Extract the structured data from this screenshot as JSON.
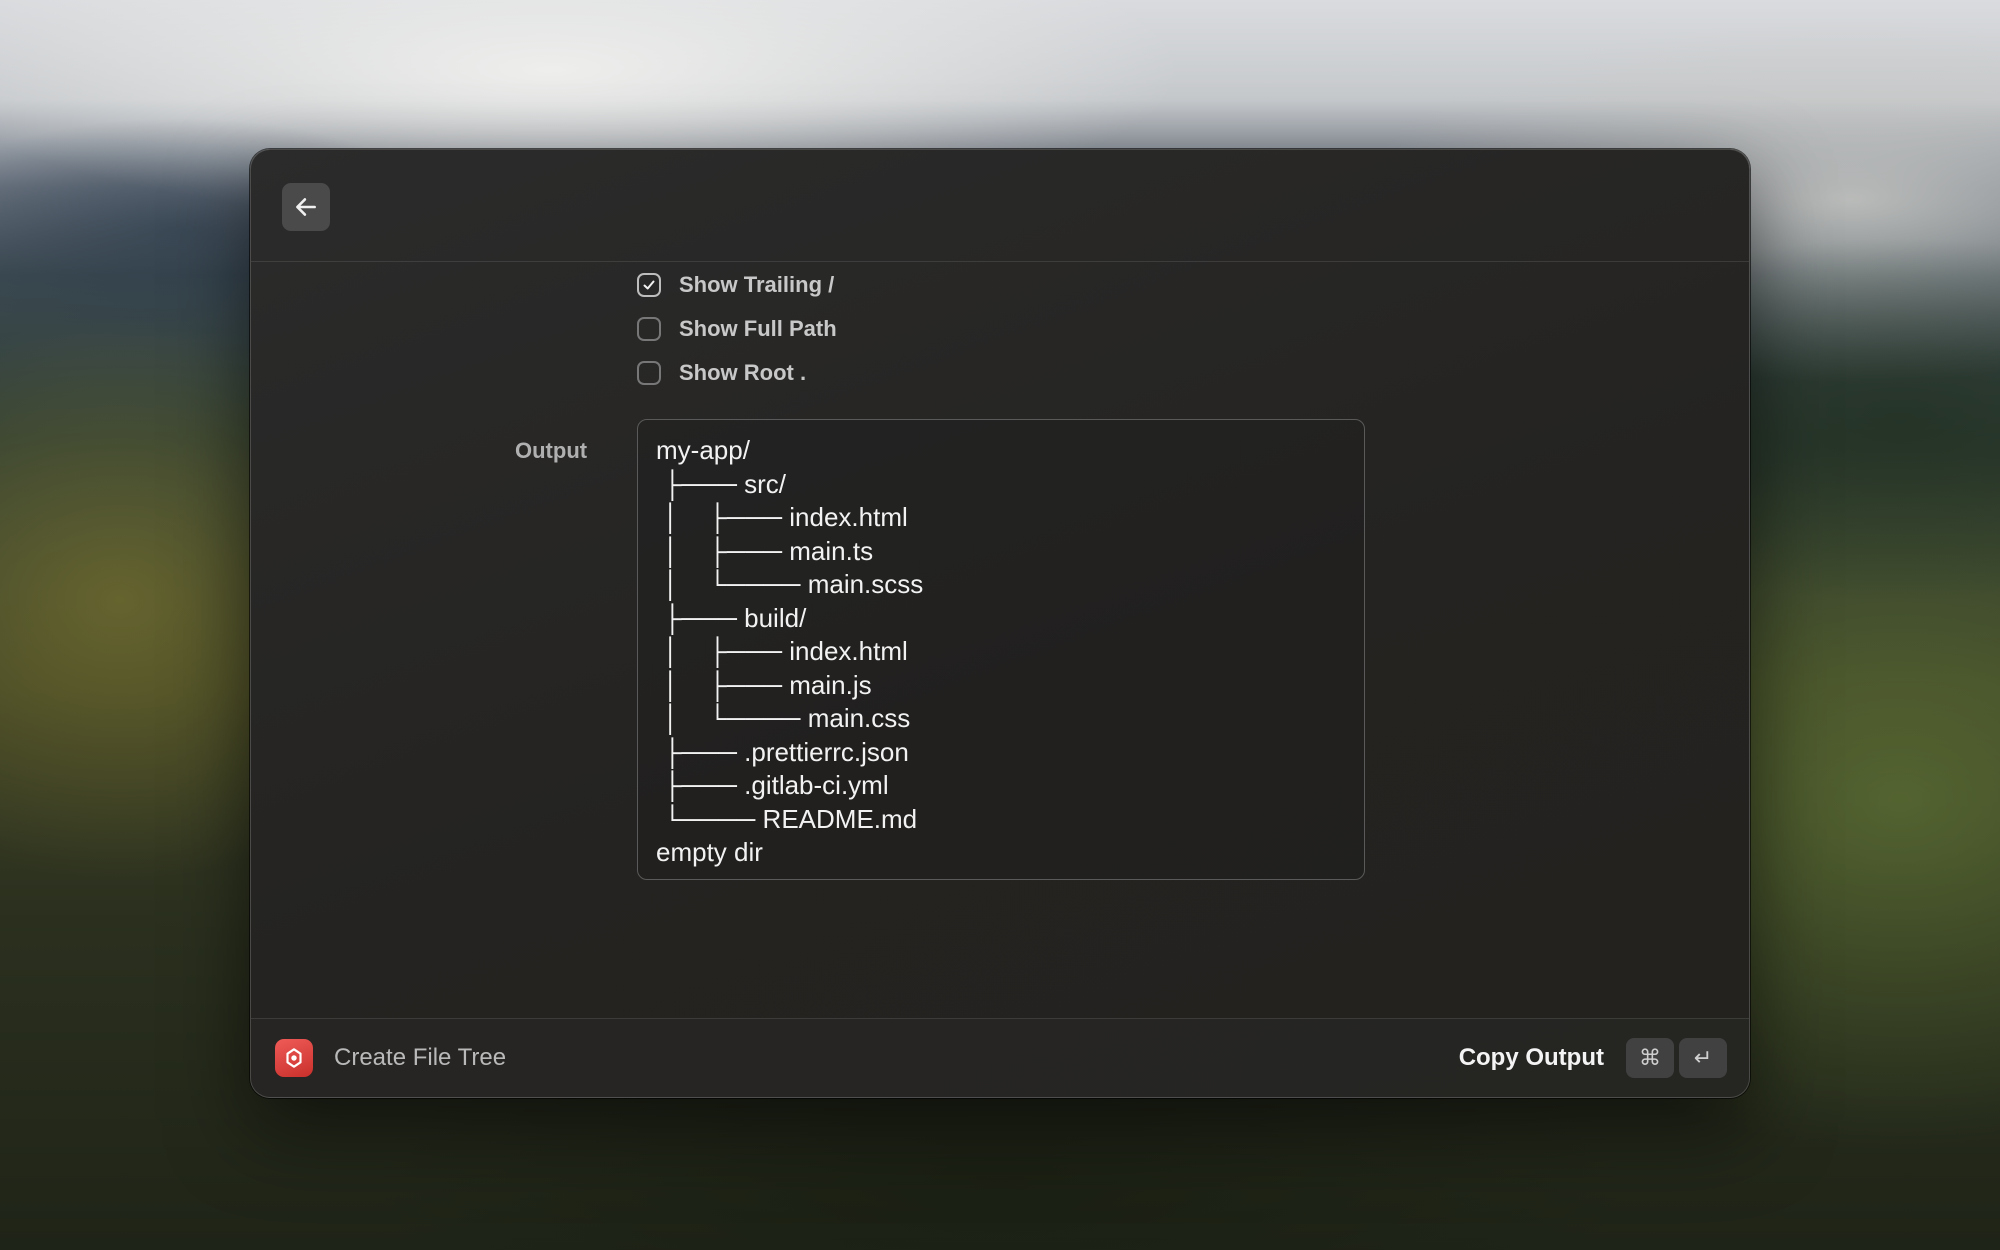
{
  "window": {
    "back_icon": "arrow-left-icon"
  },
  "options": [
    {
      "label": "Show Trailing /",
      "checked": true
    },
    {
      "label": "Show Full Path",
      "checked": false
    },
    {
      "label": "Show Root .",
      "checked": false
    }
  ],
  "output": {
    "label": "Output",
    "lines": [
      "my-app/",
      " ├─── src/",
      " │    ├─── index.html",
      " │    ├─── main.ts",
      " │    └──── main.scss",
      " ├─── build/",
      " │    ├─── index.html",
      " │    ├─── main.js",
      " │    └──── main.css",
      " ├─── .prettierrc.json",
      " ├─── .gitlab-ci.yml",
      " └──── README.md",
      "empty dir"
    ]
  },
  "footer": {
    "app_name": "Create File Tree",
    "action_label": "Copy Output",
    "shortcut_keys": [
      "⌘",
      "↵"
    ]
  },
  "colors": {
    "app_icon": "#e0443f"
  }
}
